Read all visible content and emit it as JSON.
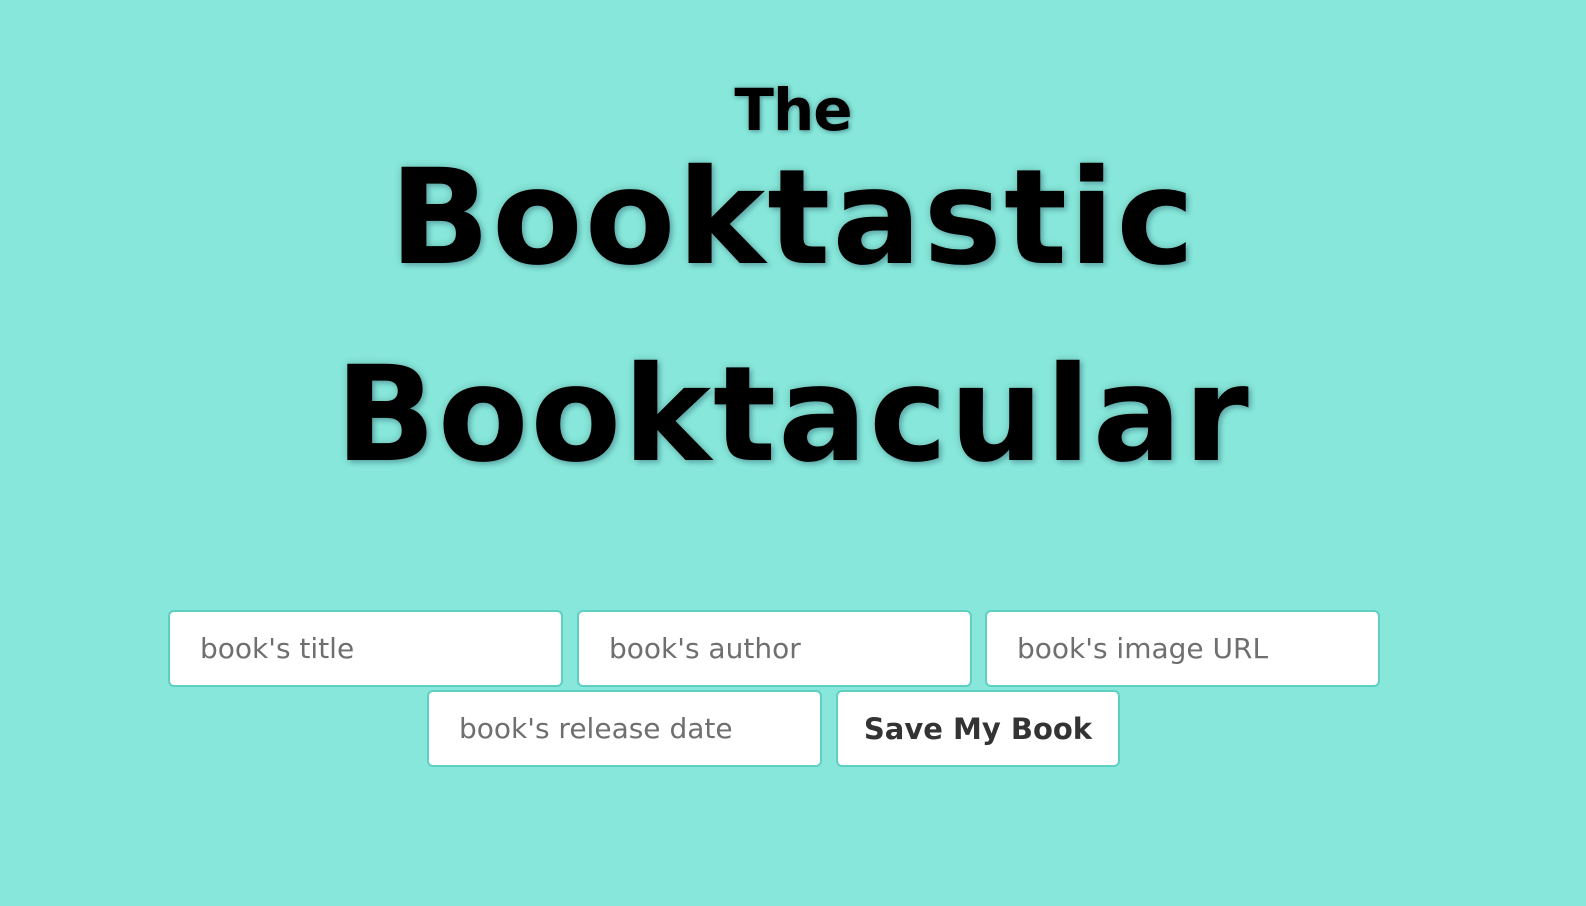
{
  "header": {
    "the": "The",
    "line1": "Booktastic",
    "line2": "Booktacular"
  },
  "form": {
    "title_placeholder": "book's title",
    "author_placeholder": "book's author",
    "image_placeholder": "book's image URL",
    "release_date_placeholder": "book's release date",
    "save_label": "Save My Book"
  },
  "colors": {
    "background": "#86e7da",
    "field_border": "#5fcfc2",
    "heading": "#000000"
  }
}
